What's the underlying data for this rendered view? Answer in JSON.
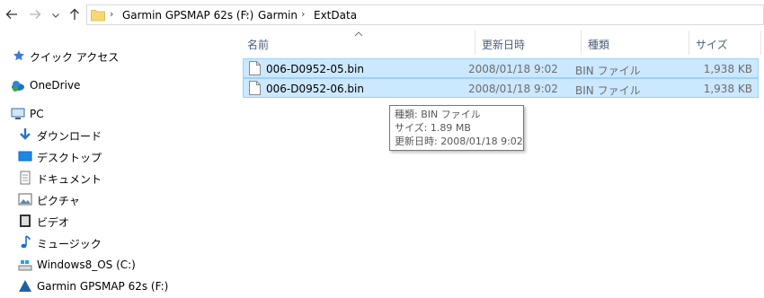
{
  "toolbar": {
    "back_icon": "back-arrow-icon",
    "forward_icon": "forward-arrow-icon",
    "up_icon": "up-arrow-icon"
  },
  "breadcrumb": {
    "items": [
      "Garmin GPSMAP 62s (F:)",
      "Garmin",
      "ExtData"
    ]
  },
  "sidebar": {
    "items": [
      {
        "label": "クイック アクセス",
        "icon": "star-icon"
      },
      {
        "label": "OneDrive",
        "icon": "cloud-icon"
      },
      {
        "label": "PC",
        "icon": "monitor-icon"
      },
      {
        "label": "ダウンロード",
        "icon": "download-arrow-icon"
      },
      {
        "label": "デスクトップ",
        "icon": "desktop-icon"
      },
      {
        "label": "ドキュメント",
        "icon": "document-icon"
      },
      {
        "label": "ピクチャ",
        "icon": "picture-icon"
      },
      {
        "label": "ビデオ",
        "icon": "video-icon"
      },
      {
        "label": "ミュージック",
        "icon": "music-note-icon"
      },
      {
        "label": "Windows8_OS (C:)",
        "icon": "drive-icon"
      },
      {
        "label": "Garmin GPSMAP 62s (F:)",
        "icon": "garmin-drive-icon"
      }
    ]
  },
  "columns": {
    "name": "名前",
    "date": "更新日時",
    "type": "種類",
    "size": "サイズ"
  },
  "files": [
    {
      "name": "006-D0952-05.bin",
      "date": "2008/01/18 9:02",
      "type": "BIN ファイル",
      "size": "1,938 KB"
    },
    {
      "name": "006-D0952-06.bin",
      "date": "2008/01/18 9:02",
      "type": "BIN ファイル",
      "size": "1,938 KB"
    }
  ],
  "tooltip": {
    "line1": "種類: BIN ファイル",
    "line2": "サイズ: 1.89 MB",
    "line3": "更新日時: 2008/01/18 9:02"
  },
  "colors": {
    "selection_bg": "#cce8ff",
    "selection_border": "#99d1ff",
    "header_text": "#4c607a"
  }
}
